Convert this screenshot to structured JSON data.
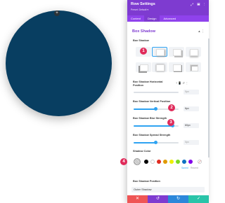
{
  "panel": {
    "title": "Row Settings",
    "subtitle": "Preset: Default ▾",
    "header_icons": "⤢ ▤ ⋮",
    "tabs": [
      "Content",
      "Design",
      "Advanced"
    ],
    "section_title": "Box Shadow",
    "section_icons": "▴ ⋮"
  },
  "labels": {
    "box_shadow": "Box Shadow",
    "horizontal": "Box Shadow Horizontal Position",
    "vertical": "Box Shadow Vertical Position",
    "blur": "Box Shadow Blur Strength",
    "spread": "Box Shadow Spread Strength",
    "shadow_color": "Shadow Color",
    "position": "Box Shadow Position"
  },
  "values": {
    "horizontal": "0px",
    "vertical": "6px",
    "blur": "60px",
    "spread": "0px",
    "position": "Outer Shadow"
  },
  "color_tabs": {
    "saved": "Saved",
    "recent": "Recent"
  },
  "swatch_colors": [
    "#000000",
    "#ffffff",
    "#e02b20",
    "#e09900",
    "#edf000",
    "#7cda24",
    "#0c71c3",
    "#8300e9"
  ],
  "badges": [
    "1",
    "2",
    "3",
    "4"
  ],
  "footer": {
    "cancel": "✕",
    "undo": "↺",
    "redo": "↻",
    "save": "✓"
  },
  "colors": {
    "accent": "#7e3bd0",
    "circle": "#083e61",
    "badge": "#e02b5a",
    "slider": "#2ea3f2"
  }
}
